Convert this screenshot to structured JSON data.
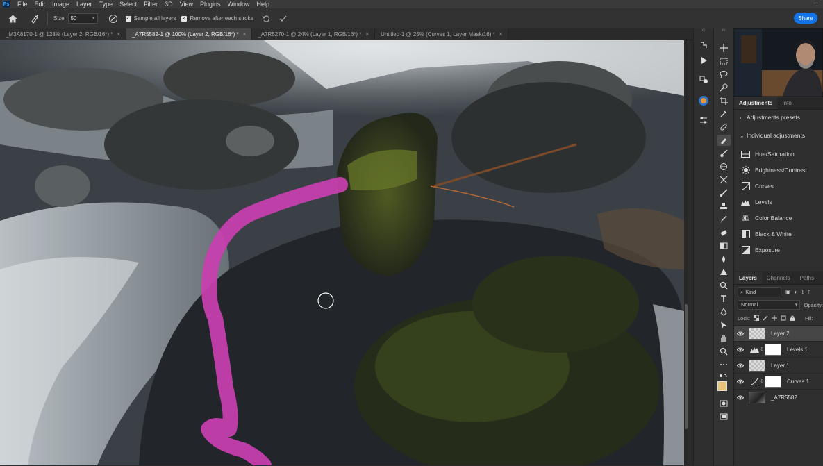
{
  "menubar": {
    "logo": "Ps",
    "items": [
      "File",
      "Edit",
      "Image",
      "Layer",
      "Type",
      "Select",
      "Filter",
      "3D",
      "View",
      "Plugins",
      "Window",
      "Help"
    ],
    "minimize_glyph": "–"
  },
  "options": {
    "size_label": "Size",
    "size_value": "50",
    "sample_all_layers": "Sample all layers",
    "remove_after_stroke": "Remove after each stroke",
    "share": "Share"
  },
  "tabs": [
    "_M3A8170-1 @ 128% (Layer 2, RGB/16*) *",
    "_A7R5582-1 @ 100% (Layer 2, RGB/16*) *",
    "_A7R5270-1 @ 24% (Layer 1, RGB/16*) *",
    "Untitled-1 @ 25% (Curves 1, Layer Mask/16) *"
  ],
  "tab_close": "×",
  "adjustments": {
    "tabs": [
      "Adjustments",
      "Info"
    ],
    "presets_label": "Adjustments presets",
    "individual_label": "Individual adjustments",
    "items": [
      "Hue/Saturation",
      "Brightness/Contrast",
      "Curves",
      "Levels",
      "Color Balance",
      "Black & White",
      "Exposure"
    ]
  },
  "layers_panel": {
    "tabs": [
      "Layers",
      "Channels",
      "Paths"
    ],
    "kind": "Kind",
    "blend_mode": "Normal",
    "opacity_label": "Opacity:",
    "lock_label": "Lock:",
    "fill_label": "Fill:",
    "layers": [
      "Layer 2",
      "Levels 1",
      "Layer 1",
      "Curves 1",
      "_A7R5582"
    ]
  },
  "colors": {
    "accent_blue": "#1473e6",
    "brush_magenta": "#c93fb0"
  }
}
